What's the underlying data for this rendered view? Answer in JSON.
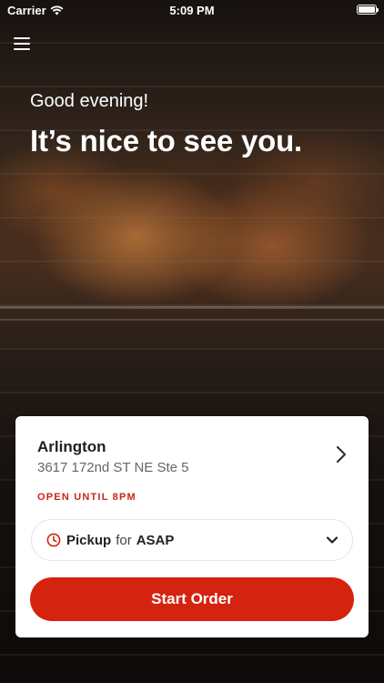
{
  "status_bar": {
    "carrier": "Carrier",
    "time": "5:09 PM"
  },
  "hero": {
    "greeting": "Good evening!",
    "headline": "It’s nice to see you."
  },
  "location_card": {
    "name": "Arlington",
    "address": "3617 172nd ST NE Ste 5",
    "hours": "OPEN UNTIL 8PM",
    "order_mode": "Pickup",
    "for_label": "for",
    "order_time": "ASAP",
    "start_button_label": "Start Order"
  },
  "colors": {
    "accent": "#d42410",
    "hours_text": "#c8261a"
  },
  "icons": {
    "menu": "hamburger-icon",
    "location_chevron": "chevron-right-icon",
    "pickup_clock": "clock-icon",
    "pickup_chevron": "chevron-down-icon"
  }
}
